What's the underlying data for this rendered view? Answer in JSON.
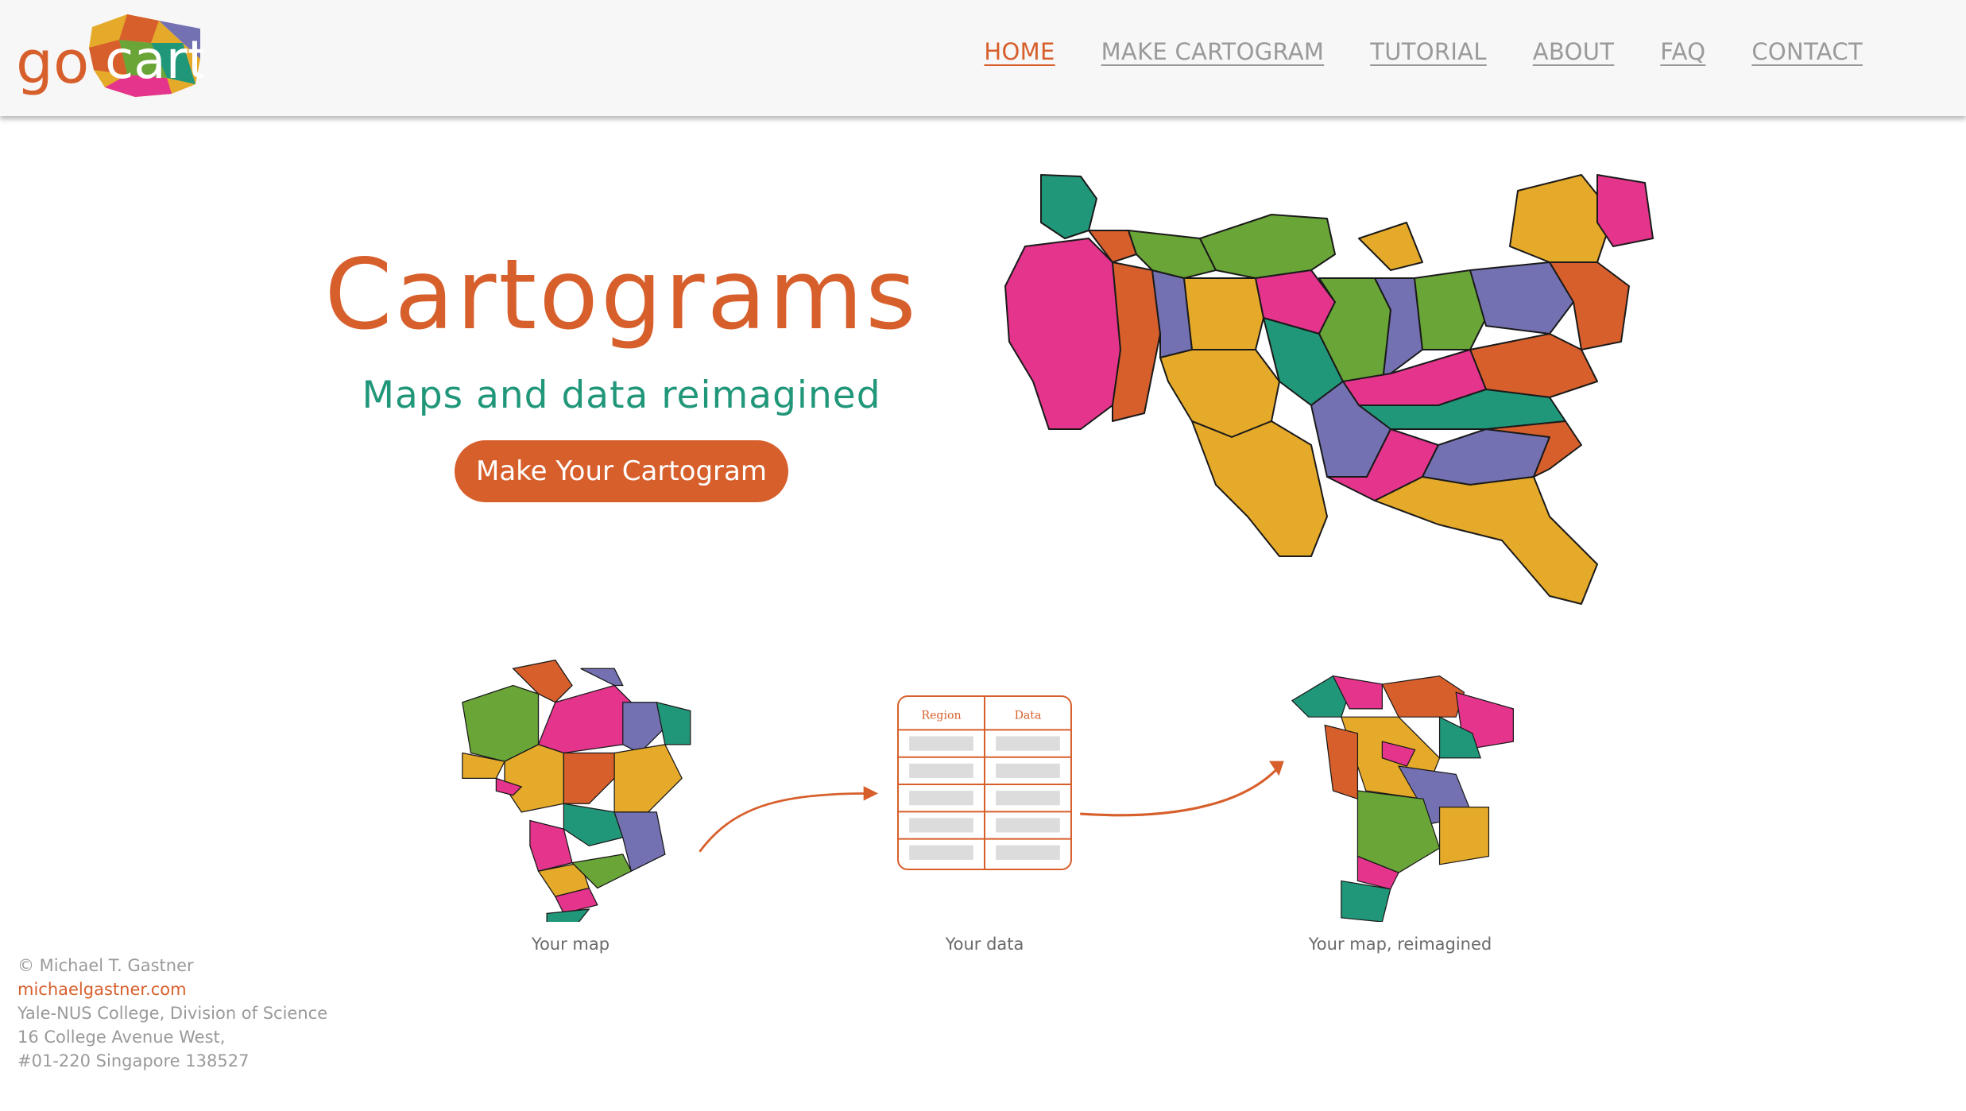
{
  "brand": {
    "logo_text": "go·cart",
    "colors": {
      "orange": "#d75f2c",
      "green": "#21977a",
      "gray": "#9a9a9a"
    }
  },
  "nav": [
    {
      "label": "HOME",
      "active": true
    },
    {
      "label": "MAKE CARTOGRAM",
      "active": false
    },
    {
      "label": "TUTORIAL",
      "active": false
    },
    {
      "label": "ABOUT",
      "active": false
    },
    {
      "label": "FAQ",
      "active": false
    },
    {
      "label": "CONTACT",
      "active": false
    }
  ],
  "hero": {
    "title": "Cartograms",
    "subtitle": "Maps and data reimagined",
    "cta_label": "Make Your Cartogram"
  },
  "steps": {
    "map_caption": "Your map",
    "data_caption": "Your data",
    "result_caption": "Your map, reimagined",
    "table_headers": [
      "Region",
      "Data"
    ]
  },
  "footer": {
    "copyright": "© Michael T. Gastner",
    "website": "michaelgastner.com",
    "line1": "Yale-NUS College, Division of Science",
    "line2": "16 College Avenue West,",
    "line3": "#01-220 Singapore 138527"
  }
}
